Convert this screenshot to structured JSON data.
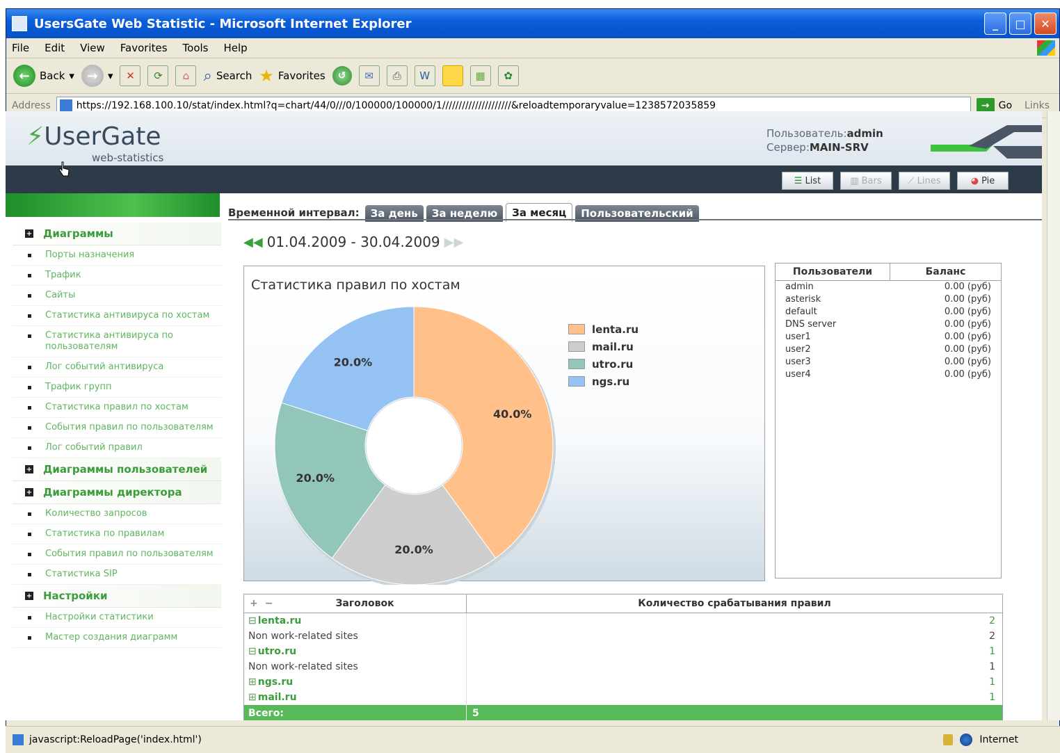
{
  "window": {
    "title": "UsersGate Web Statistic - Microsoft Internet Explorer"
  },
  "menu": [
    "File",
    "Edit",
    "View",
    "Favorites",
    "Tools",
    "Help"
  ],
  "toolbar": {
    "back": "Back",
    "search": "Search",
    "favorites": "Favorites"
  },
  "address": {
    "label": "Address",
    "url": "https://192.168.100.10/stat/index.html?q=chart/44/0///0/100000/100000/1/////////////////////&reloadtemporaryvalue=1238572035859",
    "go": "Go",
    "links": "Links"
  },
  "header": {
    "logo": "UserGate",
    "logo_sub": "web-statistics",
    "user_label": "Пользователь:",
    "user": "admin",
    "server_label": "Сервер:",
    "server": "MAIN-SRV"
  },
  "view_buttons": [
    {
      "label": "List",
      "enabled": true
    },
    {
      "label": "Bars",
      "enabled": false
    },
    {
      "label": "Lines",
      "enabled": false
    },
    {
      "label": "Pie",
      "enabled": true
    }
  ],
  "sidebar": {
    "sections": [
      {
        "title": "Диаграммы",
        "items": [
          "Порты назначения",
          "Трафик",
          "Сайты",
          "Статистика антивируса по хостам",
          "Статистика антивируса по пользователям",
          "Лог событий антивируса",
          "Трафик групп",
          "Статистика правил по хостам",
          "События правил по пользователям",
          "Лог событий правил"
        ]
      },
      {
        "title": "Диаграммы пользователей",
        "items": []
      },
      {
        "title": "Диаграммы директора",
        "items": [
          "Количество запросов",
          "Статистика по правилам",
          "События правил по пользователям",
          "Статистика SIP"
        ]
      },
      {
        "title": "Настройки",
        "items": [
          "Настройки статистики",
          "Мастер создания диаграмм"
        ]
      }
    ]
  },
  "interval": {
    "label": "Временной интервал:",
    "tabs": [
      "За день",
      "За неделю",
      "За месяц",
      "Пользовательский"
    ],
    "active": 2,
    "range": "01.04.2009 - 30.04.2009"
  },
  "chart_data": {
    "type": "pie",
    "title": "Статистика правил по хостам",
    "categories": [
      "lenta.ru",
      "mail.ru",
      "utro.ru",
      "ngs.ru"
    ],
    "values": [
      40.0,
      20.0,
      20.0,
      20.0
    ],
    "labels": [
      "40.0%",
      "20.0%",
      "20.0%",
      "20.0%"
    ],
    "colors": [
      "#ffc08a",
      "#cdcdcd",
      "#93c6bb",
      "#94c2f2"
    ],
    "legend_position": "right"
  },
  "users_table": {
    "headers": [
      "Пользователи",
      "Баланс"
    ],
    "rows": [
      [
        "admin",
        "0.00 (руб)"
      ],
      [
        "asterisk",
        "0.00 (руб)"
      ],
      [
        "default",
        "0.00 (руб)"
      ],
      [
        "DNS server",
        "0.00 (руб)"
      ],
      [
        "user1",
        "0.00 (руб)"
      ],
      [
        "user2",
        "0.00 (руб)"
      ],
      [
        "user3",
        "0.00 (руб)"
      ],
      [
        "user4",
        "0.00 (руб)"
      ]
    ]
  },
  "rules_table": {
    "headers": [
      "Заголовок",
      "Количество срабатывания правил"
    ],
    "expand": "+",
    "collapse": "−",
    "rows": [
      {
        "title": "lenta.ru",
        "count": "2",
        "kind": "group",
        "sign": "⊟"
      },
      {
        "title": "Non work-related sites",
        "count": "2",
        "kind": "sub",
        "sign": ""
      },
      {
        "title": "utro.ru",
        "count": "1",
        "kind": "group",
        "sign": "⊟"
      },
      {
        "title": "Non work-related sites",
        "count": "1",
        "kind": "sub",
        "sign": ""
      },
      {
        "title": "ngs.ru",
        "count": "1",
        "kind": "group",
        "sign": "⊞"
      },
      {
        "title": "mail.ru",
        "count": "1",
        "kind": "group",
        "sign": "⊞"
      }
    ],
    "total_label": "Всего:",
    "total_value": "5"
  },
  "status": {
    "text": "javascript:ReloadPage('index.html')",
    "zone": "Internet"
  }
}
